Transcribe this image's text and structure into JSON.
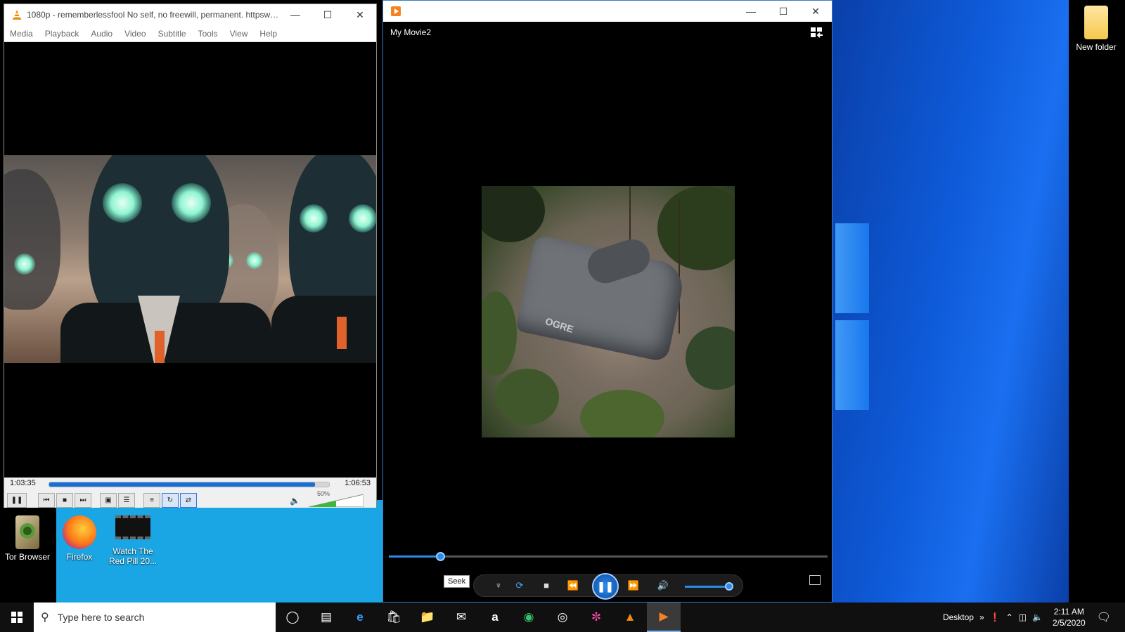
{
  "colors": {
    "desktop_blue": "#0e5ad8",
    "accent_blue": "#2a8be8",
    "vlc_seek": "#1a6fd6",
    "taskbar": "#101010"
  },
  "desktop": {
    "icons": [
      {
        "label": "Tor Browser",
        "icon": "tor-browser-icon"
      },
      {
        "label": "Firefox",
        "icon": "firefox-icon"
      },
      {
        "label": "Watch The Red Pill 20...",
        "icon": "video-file-icon"
      },
      {
        "label": "New folder",
        "icon": "folder-icon"
      }
    ]
  },
  "vlc": {
    "title": "1080p - rememberlessfool No self, no freewill, permanent. httpsww...",
    "menu": [
      "Media",
      "Playback",
      "Audio",
      "Video",
      "Subtitle",
      "Tools",
      "View",
      "Help"
    ],
    "time_elapsed": "1:03:35",
    "time_total": "1:06:53",
    "progress": 0.95,
    "volume_label": "50%",
    "volume": 0.5
  },
  "movies_tv": {
    "title": "My Movie2",
    "tank_label": "OGRE",
    "tooltip": "Seek",
    "progress": 0.11,
    "volume": 0.9
  },
  "taskbar": {
    "search_placeholder": "Type here to search",
    "desktop_label": "Desktop",
    "time": "2:11 AM",
    "date": "2/5/2020"
  }
}
